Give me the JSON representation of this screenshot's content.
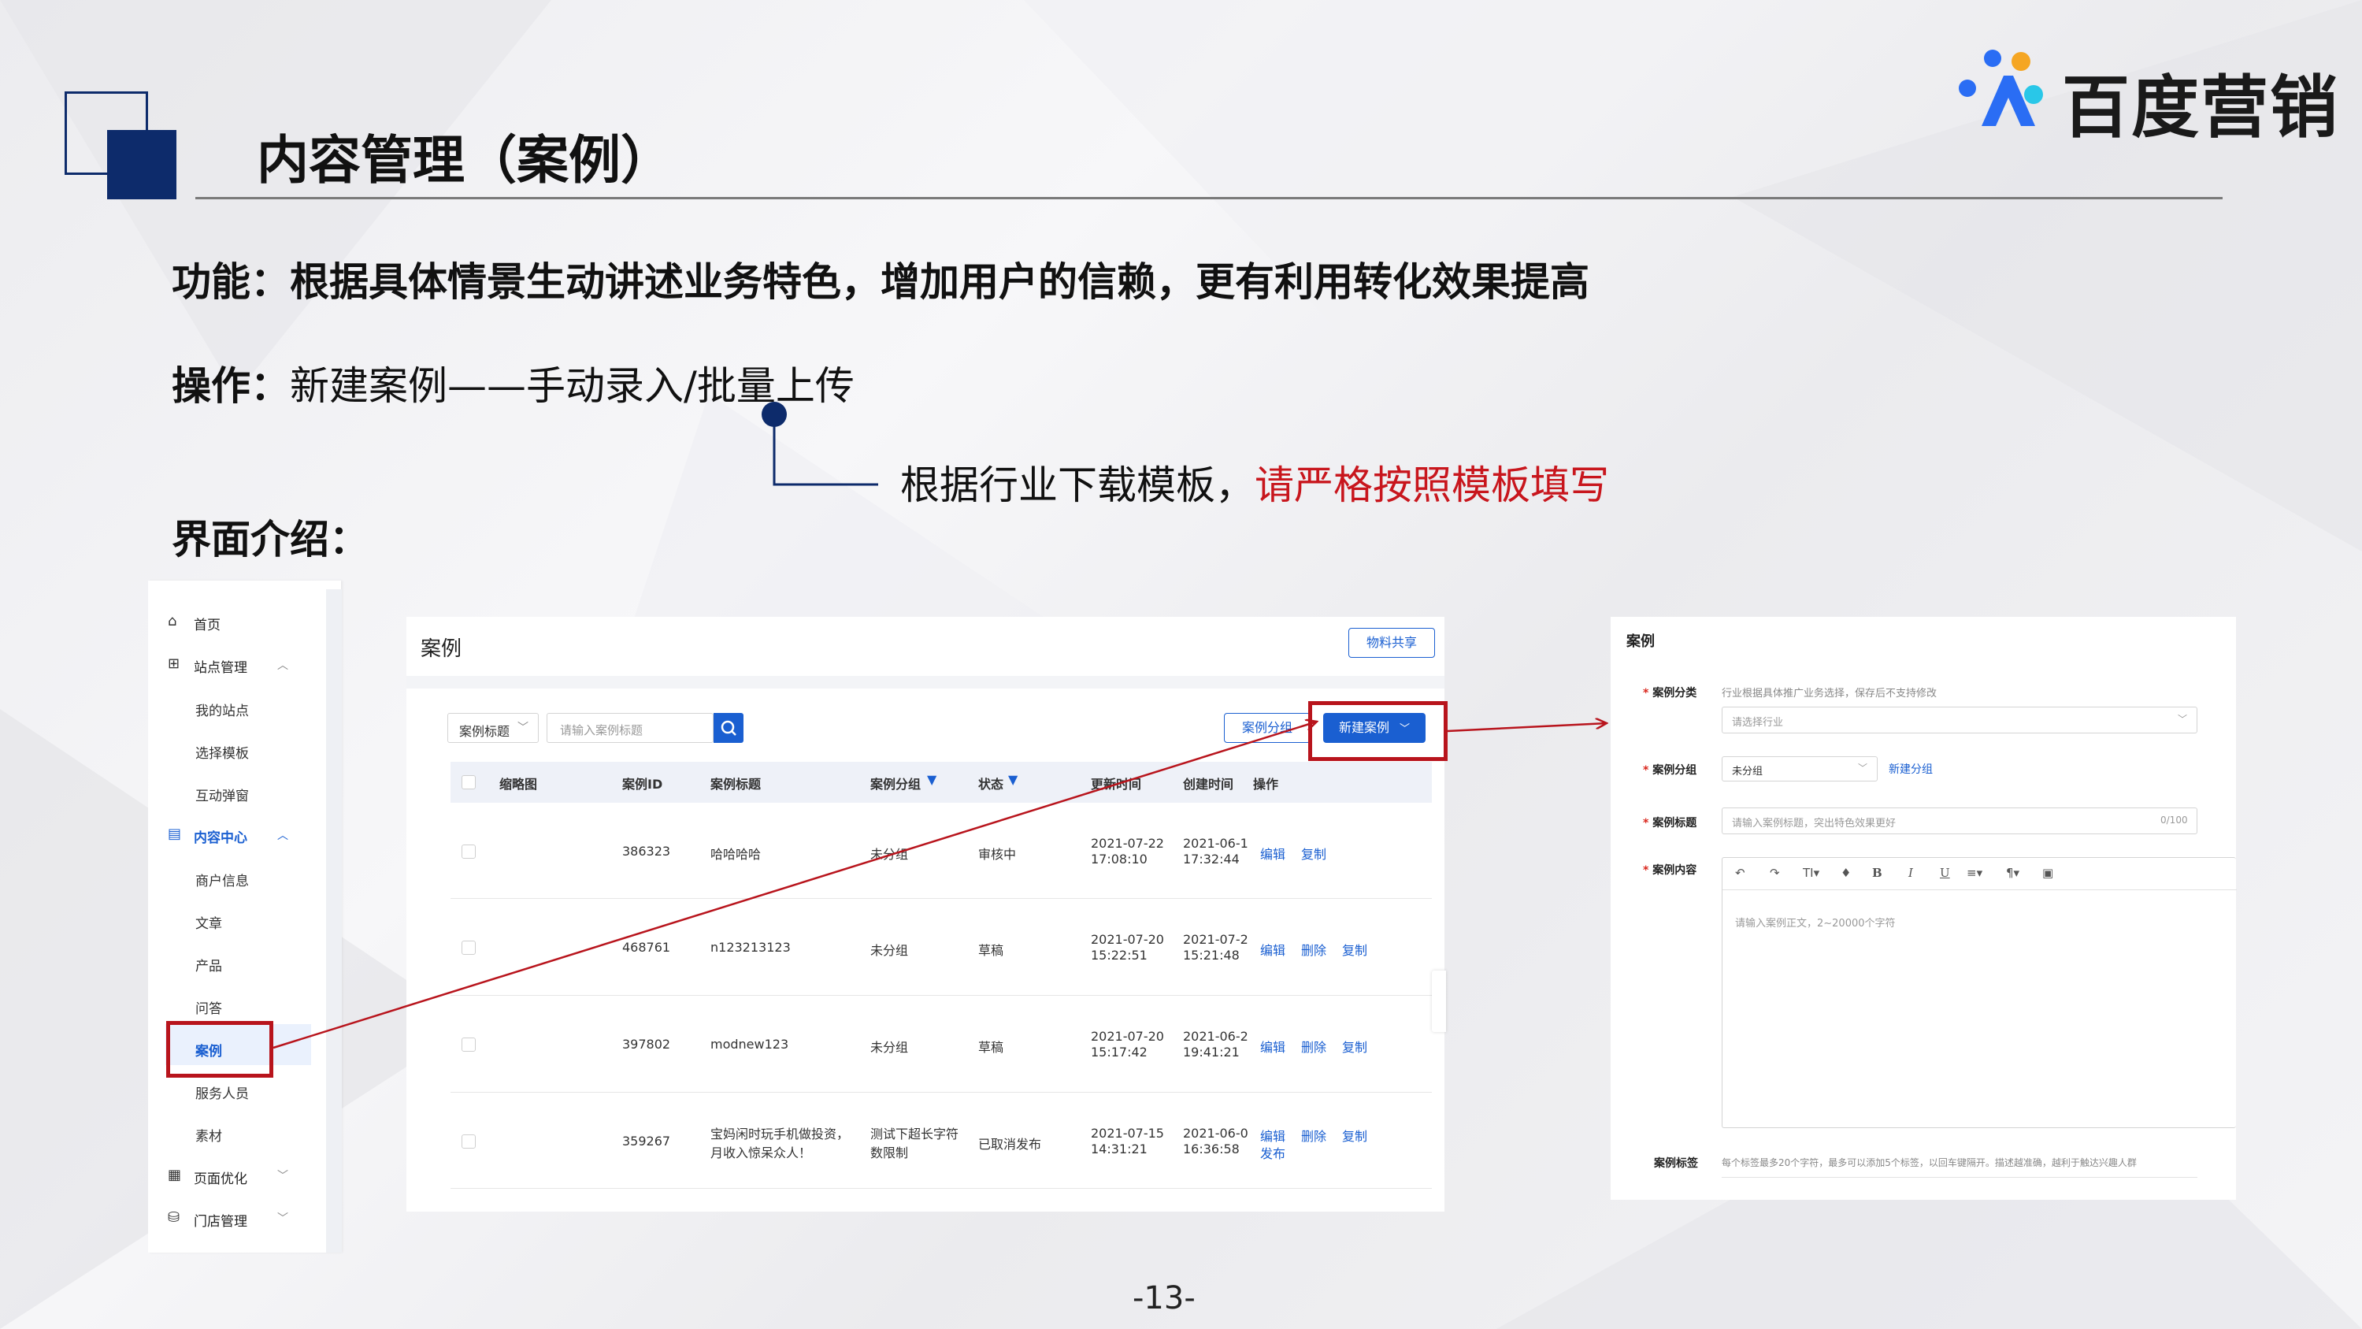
{
  "slide": {
    "title": "内容管理（案例）",
    "logo_text": "百度营销",
    "function_label": "功能：",
    "function_text": "根据具体情景生动讲述业务特色，增加用户的信赖，更有利用转化效果提高",
    "operation_label": "操作：",
    "operation_text": "新建案例——手动录入/批量上传",
    "callout_text": "根据行业下载模板，",
    "callout_emphasis": "请严格按照模板填写",
    "interface_label": "界面介绍：",
    "page_number": "-13-",
    "colors": {
      "navy": "#0d2b6b",
      "red": "#c8161d",
      "link_blue": "#1a5fd1"
    }
  },
  "sidebar": {
    "items": [
      {
        "label": "首页",
        "icon": "home-icon"
      },
      {
        "label": "站点管理",
        "icon": "grid-icon",
        "expanded": true
      },
      {
        "label": "我的站点"
      },
      {
        "label": "选择模板"
      },
      {
        "label": "互动弹窗"
      },
      {
        "label": "内容中心",
        "icon": "content-icon",
        "expanded": true
      },
      {
        "label": "商户信息"
      },
      {
        "label": "文章"
      },
      {
        "label": "产品"
      },
      {
        "label": "问答"
      },
      {
        "label": "案例",
        "active": true
      },
      {
        "label": "服务人员"
      },
      {
        "label": "素材"
      },
      {
        "label": "页面优化",
        "icon": "page-optimize-icon"
      },
      {
        "label": "门店管理",
        "icon": "store-icon"
      }
    ]
  },
  "case_list": {
    "title": "案例",
    "share_button": "物料共享",
    "filter_select": "案例标题",
    "search_placeholder": "请输入案例标题",
    "group_button": "案例分组",
    "new_button": "新建案例",
    "columns": [
      "缩略图",
      "案例ID",
      "案例标题",
      "案例分组",
      "状态",
      "更新时间",
      "创建时间",
      "操作"
    ],
    "rows": [
      {
        "id": "386323",
        "title": "哈哈哈哈",
        "group": "未分组",
        "status": "审核中",
        "updated": [
          "2021-07-22",
          "17:08:10"
        ],
        "created": [
          "2021-06-1",
          "17:32:44"
        ],
        "actions": [
          "编辑",
          "复制"
        ]
      },
      {
        "id": "468761",
        "title": "n123213123",
        "group": "未分组",
        "status": "草稿",
        "updated": [
          "2021-07-20",
          "15:22:51"
        ],
        "created": [
          "2021-07-2",
          "15:21:48"
        ],
        "actions": [
          "编辑",
          "删除",
          "复制"
        ]
      },
      {
        "id": "397802",
        "title": "modnew123",
        "group": "未分组",
        "status": "草稿",
        "updated": [
          "2021-07-20",
          "15:17:42"
        ],
        "created": [
          "2021-06-2",
          "19:41:21"
        ],
        "actions": [
          "编辑",
          "删除",
          "复制"
        ]
      },
      {
        "id": "359267",
        "title": [
          "宝妈闲时玩手机做投资，",
          "月收入惊呆众人！"
        ],
        "group": [
          "测试下超长字符",
          "数限制"
        ],
        "status": "已取消发布",
        "updated": [
          "2021-07-15",
          "14:31:21"
        ],
        "created": [
          "2021-06-0",
          "16:36:58"
        ],
        "actions": [
          "编辑",
          "删除",
          "复制"
        ],
        "extra_action": "发布"
      }
    ]
  },
  "case_form": {
    "title": "案例",
    "category_label": "案例分类",
    "category_hint": "行业根据具体推广业务选择，保存后不支持修改",
    "category_placeholder": "请选择行业",
    "group_label": "案例分组",
    "group_value": "未分组",
    "new_group_link": "新建分组",
    "title_label": "案例标题",
    "title_placeholder": "请输入案例标题，突出特色效果更好",
    "title_counter": "0/100",
    "content_label": "案例内容",
    "content_placeholder": "请输入案例正文，2~20000个字符",
    "toolbar": [
      "↶",
      "↷",
      "TI▾",
      "♦",
      "B",
      "I",
      "U",
      "≡▾",
      "¶▾",
      "▣"
    ],
    "tags_label": "案例标签",
    "tags_hint": "每个标签最多20个字符，最多可以添加5个标签，以回车键隔开。描述越准确，越利于触达兴趣人群",
    "required_mark": "*"
  }
}
